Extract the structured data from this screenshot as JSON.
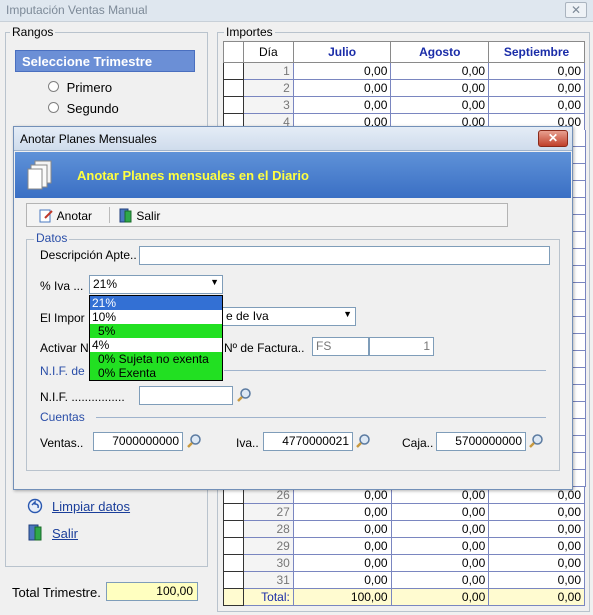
{
  "window": {
    "title": "Imputación Ventas Manual",
    "close": "✕"
  },
  "rangos": {
    "label": "Rangos",
    "header": "Seleccione Trimestre",
    "options": [
      "Primero",
      "Segundo"
    ]
  },
  "actions": {
    "limpiar": "Limpiar datos",
    "salir": "Salir"
  },
  "total_trimestre": {
    "label": "Total Trimestre.",
    "value": "100,00"
  },
  "importes": {
    "label": "Importes",
    "columns": [
      "Día",
      "Julio",
      "Agosto",
      "Septiembre"
    ],
    "top_rows": [
      {
        "dia": "1",
        "v": [
          "0,00",
          "0,00",
          "0,00"
        ]
      },
      {
        "dia": "2",
        "v": [
          "0,00",
          "0,00",
          "0,00"
        ]
      },
      {
        "dia": "3",
        "v": [
          "0,00",
          "0,00",
          "0,00"
        ]
      },
      {
        "dia": "4",
        "v": [
          "0,00",
          "0,00",
          "0,00"
        ]
      }
    ],
    "bottom_rows": [
      {
        "dia": "26",
        "v": [
          "0,00",
          "0,00",
          "0,00"
        ]
      },
      {
        "dia": "27",
        "v": [
          "0,00",
          "0,00",
          "0,00"
        ]
      },
      {
        "dia": "28",
        "v": [
          "0,00",
          "0,00",
          "0,00"
        ]
      },
      {
        "dia": "29",
        "v": [
          "0,00",
          "0,00",
          "0,00"
        ]
      },
      {
        "dia": "30",
        "v": [
          "0,00",
          "0,00",
          "0,00"
        ]
      },
      {
        "dia": "31",
        "v": [
          "0,00",
          "0,00",
          "0,00"
        ]
      }
    ],
    "total": {
      "label": "Total:",
      "v": [
        "100,00",
        "0,00",
        "0,00"
      ]
    }
  },
  "dialog": {
    "title": "Anotar Planes Mensuales",
    "close": "✕",
    "banner": "Anotar Planes mensuales en el Diario",
    "toolbar": {
      "anotar": "Anotar",
      "salir": "Salir"
    },
    "datos_label": "Datos",
    "descripcion_label": "Descripción Apte..",
    "descripcion_value": "",
    "iva_label": "% Iva ...",
    "iva_selected": "21%",
    "iva_options": [
      "21%",
      "10%",
      "5%",
      "4%",
      "0% Sujeta no exenta",
      "0% Exenta"
    ],
    "importe_label": "El Impor",
    "importe_select_value": "e de Iva",
    "activar_label": "Activar N",
    "factura_label": "Nº de Factura..",
    "factura_serie": "FS",
    "factura_num": "1",
    "nif_section": "N.I.F. de",
    "nif_label": "N.I.F. ................",
    "nif_value": "",
    "cuentas_label": "Cuentas",
    "ventas_label": "Ventas..",
    "ventas_value": "7000000000",
    "iva2_label": "Iva..",
    "iva2_value": "4770000021",
    "caja_label": "Caja..",
    "caja_value": "5700000000"
  },
  "colors": {
    "banner": "#3a6fc4",
    "banner_text": "#ffff40",
    "highlight_green": "#22e022",
    "selected_blue": "#3370d4"
  }
}
